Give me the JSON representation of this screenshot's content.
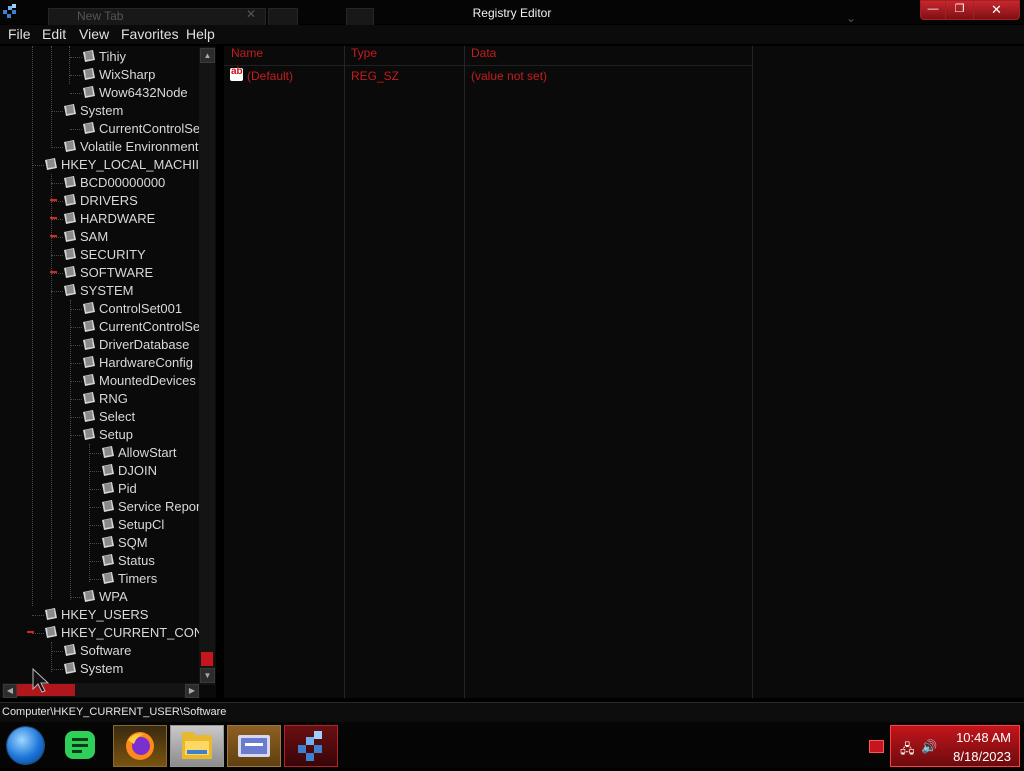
{
  "window": {
    "title": "Registry Editor",
    "min_glyph": "—",
    "max_glyph": "❐",
    "close_glyph": "✕"
  },
  "background_tab": {
    "label": "New Tab",
    "close_glyph": "✕",
    "chevron_glyph": "⌄"
  },
  "menu": {
    "file": "File",
    "edit": "Edit",
    "view": "View",
    "favorites": "Favorites",
    "help": "Help"
  },
  "tree": {
    "tihiy": "Tihiy",
    "wixsharp": "WixSharp",
    "wow6432node": "Wow6432Node",
    "system": "System",
    "currentcontrolset_user": "CurrentControlSe",
    "volatile_environment": "Volatile Environment",
    "hklm": "HKEY_LOCAL_MACHII",
    "bcd": "BCD00000000",
    "drivers": "DRIVERS",
    "hardware": "HARDWARE",
    "sam": "SAM",
    "security": "SECURITY",
    "software": "SOFTWARE",
    "system_hklm": "SYSTEM",
    "controlset001": "ControlSet001",
    "currentcontrolset": "CurrentControlSe",
    "driverdatabase": "DriverDatabase",
    "hardwareconfig": "HardwareConfig",
    "mounteddevices": "MountedDevices",
    "rng": "RNG",
    "select": "Select",
    "setup": "Setup",
    "allowstart": "AllowStart",
    "djoin": "DJOIN",
    "pid": "Pid",
    "service_reporting": "Service Repor",
    "setupcl": "SetupCl",
    "sqm": "SQM",
    "status": "Status",
    "timers": "Timers",
    "wpa": "WPA",
    "hku": "HKEY_USERS",
    "hkcc": "HKEY_CURRENT_CON",
    "hkcc_software": "Software",
    "hkcc_system": "System"
  },
  "scroll": {
    "up": "▲",
    "down": "▼",
    "left": "◀",
    "right": "▶"
  },
  "list": {
    "columns": {
      "name": "Name",
      "type": "Type",
      "data": "Data"
    },
    "row": {
      "icon": "ab",
      "name": "(Default)",
      "type": "REG_SZ",
      "data": "(value not set)"
    }
  },
  "status": {
    "path": "Computer\\HKEY_CURRENT_USER\\Software"
  },
  "clock": {
    "time": "10:48 AM",
    "date": "8/18/2023"
  },
  "tray": {
    "network_glyph": "🖧",
    "volume_glyph": "🔊"
  },
  "colors": {
    "accent": "#c4161c",
    "list_text": "#c51c1c",
    "background": "#0a0a0a"
  },
  "icons": [
    "regedit-icon",
    "folder-icon",
    "string-value-icon",
    "start-orb-icon",
    "notes-app-icon",
    "firefox-icon",
    "file-explorer-icon",
    "remote-desktop-icon",
    "network-icon",
    "volume-icon"
  ]
}
